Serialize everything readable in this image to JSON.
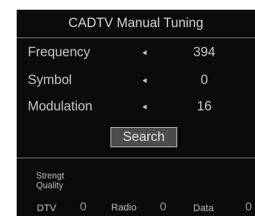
{
  "header": {
    "title": "CADTV Manual Tuning"
  },
  "settings": [
    {
      "label": "Frequency",
      "value": "394",
      "arrow_icon": "left-arrow-icon"
    },
    {
      "label": "Symbol",
      "value": "0",
      "arrow_icon": "left-arrow-icon"
    },
    {
      "label": "Modulation",
      "value": "16",
      "arrow_icon": "left-arrow-icon"
    }
  ],
  "search_button": {
    "label": "Search"
  },
  "signal": {
    "strength_label": "Strengt",
    "quality_label": "Quality"
  },
  "counts": {
    "dtv_label": "DTV",
    "dtv_value": "0",
    "radio_label": "Radio",
    "radio_value": "0",
    "data_label": "Data",
    "data_value": "0"
  },
  "colors": {
    "panel_bg": "#0b0b0b",
    "text": "#c8c8c8",
    "divider": "#8a8a8a",
    "button_bg": "#4c4c4c"
  }
}
